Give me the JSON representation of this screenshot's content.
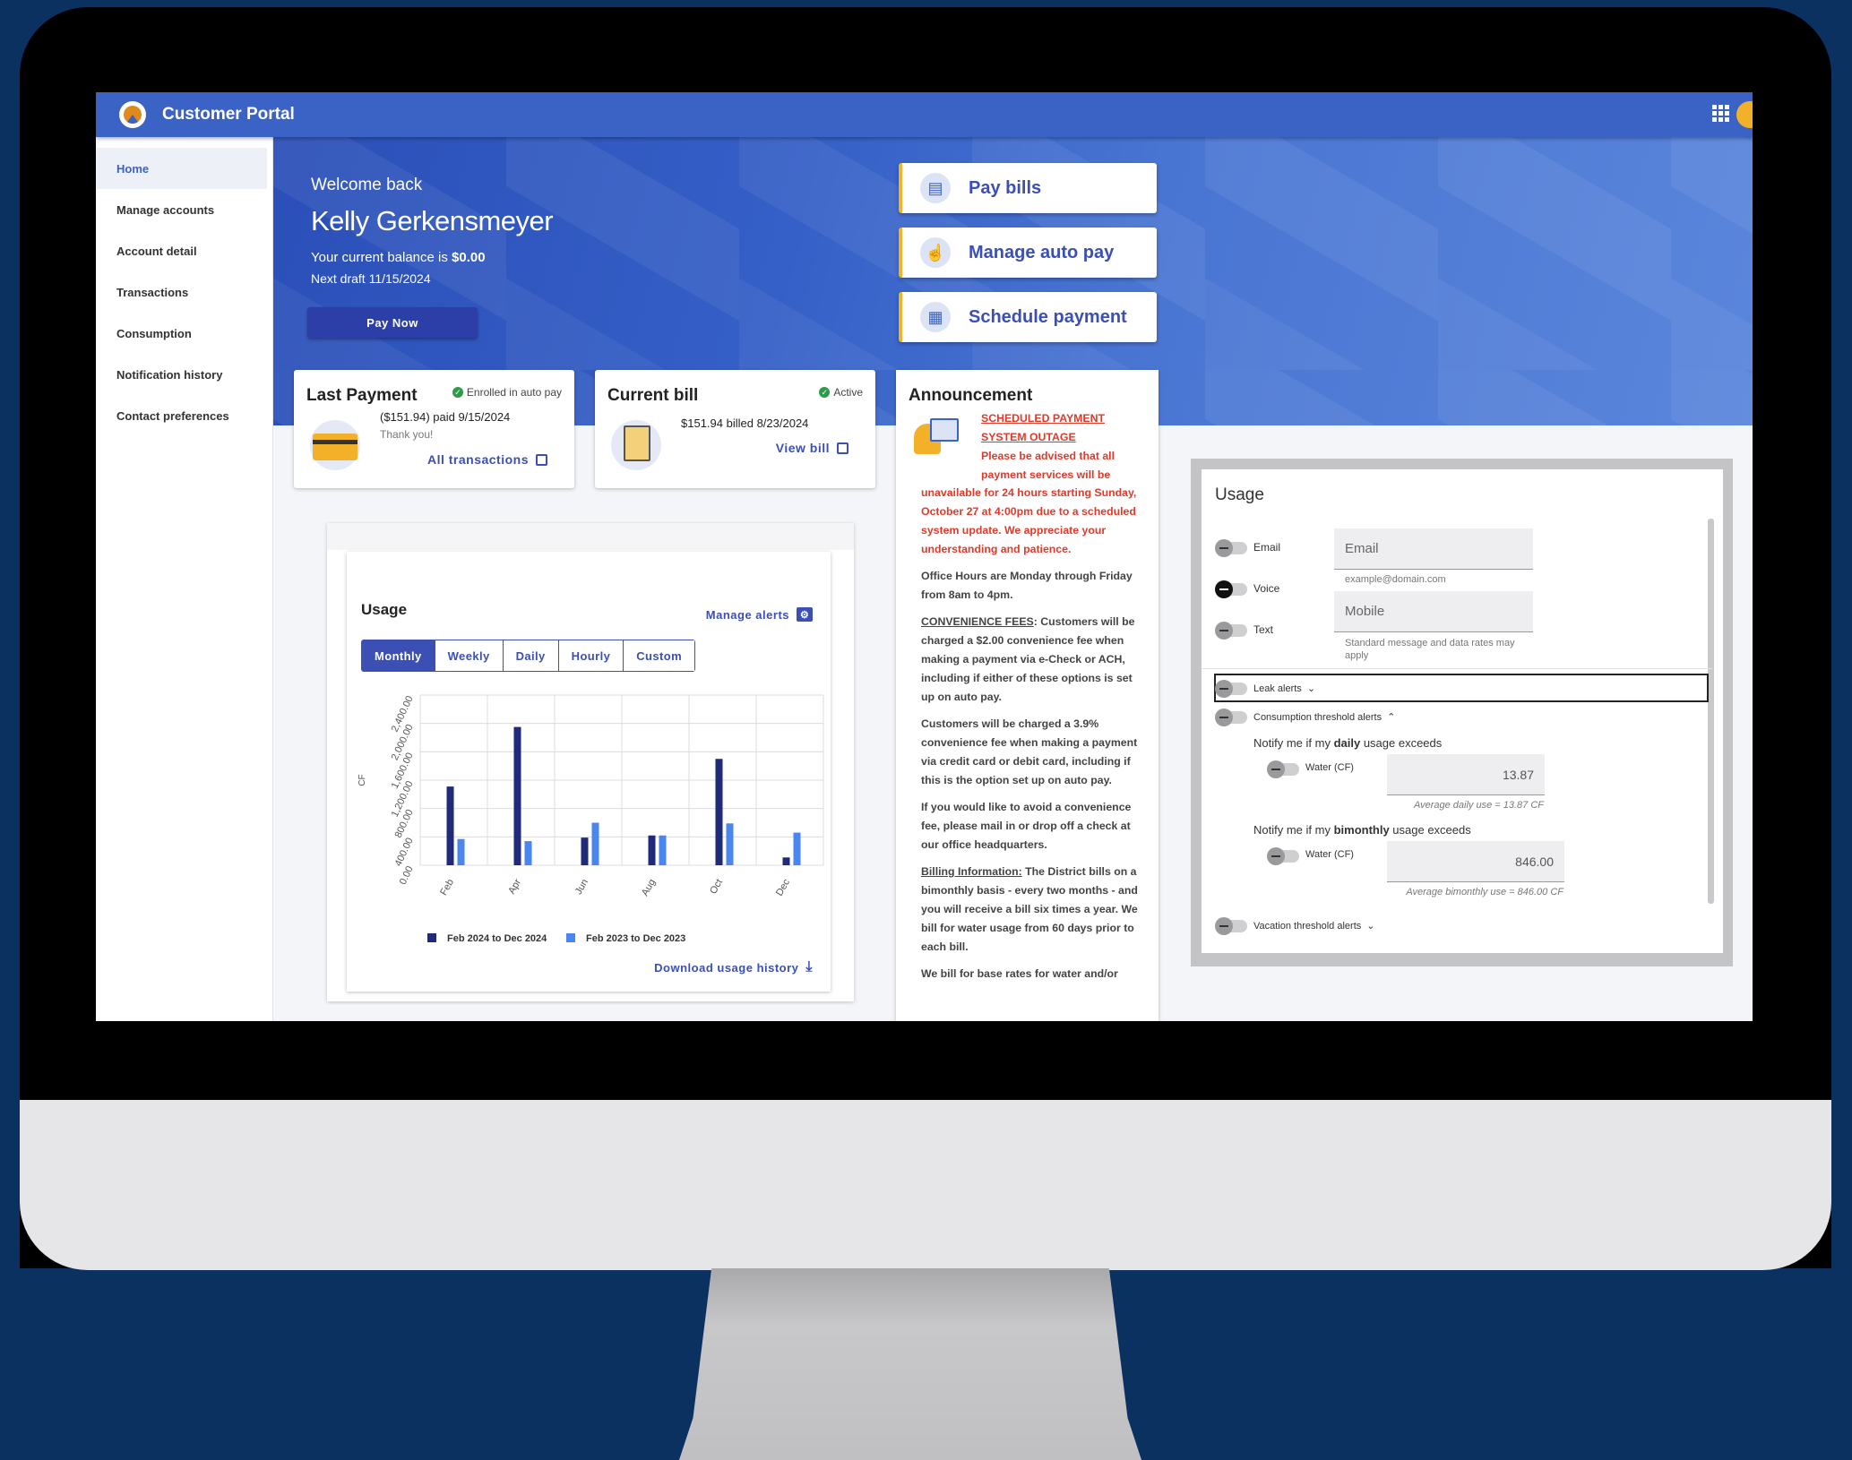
{
  "app": {
    "title": "Customer Portal"
  },
  "sidebar": {
    "items": [
      {
        "label": "Home"
      },
      {
        "label": "Manage accounts"
      },
      {
        "label": "Account detail"
      },
      {
        "label": "Transactions"
      },
      {
        "label": "Consumption"
      },
      {
        "label": "Notification history"
      },
      {
        "label": "Contact preferences"
      }
    ]
  },
  "hero": {
    "welcome": "Welcome back",
    "name": "Kelly Gerkensmeyer",
    "balance_prefix": "Your current balance is ",
    "balance": "$0.00",
    "next_draft": "Next draft 11/15/2024",
    "pay_now": "Pay Now"
  },
  "quick_actions": [
    {
      "label": "Pay bills",
      "icon": "bill-icon"
    },
    {
      "label": "Manage auto pay",
      "icon": "touch-icon"
    },
    {
      "label": "Schedule payment",
      "icon": "calendar-icon"
    }
  ],
  "last_payment": {
    "title": "Last Payment",
    "status": "Enrolled in auto pay",
    "amount": "($151.94) paid 9/15/2024",
    "thanks": "Thank you!",
    "link": "All transactions"
  },
  "current_bill": {
    "title": "Current bill",
    "status": "Active",
    "amount": "$151.94 billed 8/23/2024",
    "link": "View bill"
  },
  "usage": {
    "title": "Usage",
    "manage_alerts": "Manage alerts",
    "tabs": [
      "Monthly",
      "Weekly",
      "Daily",
      "Hourly",
      "Custom"
    ],
    "selected_tab": "Monthly",
    "download": "Download usage history"
  },
  "chart_data": {
    "type": "bar",
    "categories": [
      "Feb",
      "Apr",
      "Jun",
      "Aug",
      "Oct",
      "Dec"
    ],
    "ylabel": "CF",
    "ylim": [
      0,
      2400
    ],
    "yticks": [
      "0.00",
      "400.00",
      "800.00",
      "1,200.00",
      "1,600.00",
      "2,000.00",
      "2,400.00"
    ],
    "series": [
      {
        "name": "Feb 2024 to Dec 2024",
        "color": "#1f2a7a",
        "values": [
          1110,
          1950,
          390,
          420,
          1500,
          110
        ]
      },
      {
        "name": "Feb 2023 to Dec 2023",
        "color": "#4a86ef",
        "values": [
          370,
          340,
          600,
          420,
          590,
          460
        ]
      }
    ],
    "legend_position": "bottom",
    "grid": true
  },
  "announcement": {
    "title": "Announcement",
    "headline": "SCHEDULED PAYMENT SYSTEM OUTAGE",
    "red_text_1": "Please be advised that all payment services will be",
    "red_text_2": "unavailable for 24 hours starting Sunday, October 27 at 4:00pm due to a scheduled system update. We appreciate your understanding and patience.",
    "office_hours": "Office Hours are Monday through Friday from 8am to 4pm.",
    "fees_label": "CONVENIENCE FEES",
    "fees_text": ": Customers will be charged a $2.00 convenience fee when making a payment via e-Check or ACH, including if either of these options is set up on auto pay.",
    "card_fee": "Customers will be charged a  3.9% convenience fee when making a payment via credit card or debit card, including if this is the option set up on auto pay.",
    "avoid_fee": "If you would like to avoid a convenience fee, please mail in or drop off a check at our office headquarters.",
    "billing_label": "Billing Information:",
    "billing_text": " The District bills on a bimonthly basis - every two months - and you will receive a bill six times a year. We bill for water usage from 60 days prior to each bill.",
    "base_rates": "We bill for base rates for water and/or"
  },
  "alerts_panel": {
    "title": "Usage",
    "email_label": "Email",
    "voice_label": "Voice",
    "text_label": "Text",
    "email_placeholder": "Email",
    "email_hint": "example@domain.com",
    "mobile_placeholder": "Mobile",
    "mobile_hint": "Standard message and data rates may apply",
    "leak_alerts": "Leak alerts",
    "consumption_alerts": "Consumption threshold alerts",
    "daily_prefix": "Notify me if my ",
    "daily_bold": "daily",
    "daily_suffix": " usage exceeds",
    "water_label": "Water (CF)",
    "daily_value": "13.87",
    "daily_avg": "Average daily use = 13.87 CF",
    "bimonthly_bold": "bimonthly",
    "bimonthly_value": "846.00",
    "bimonthly_avg": "Average bimonthly use = 846.00 CF",
    "vacation_alerts": "Vacation threshold alerts"
  }
}
